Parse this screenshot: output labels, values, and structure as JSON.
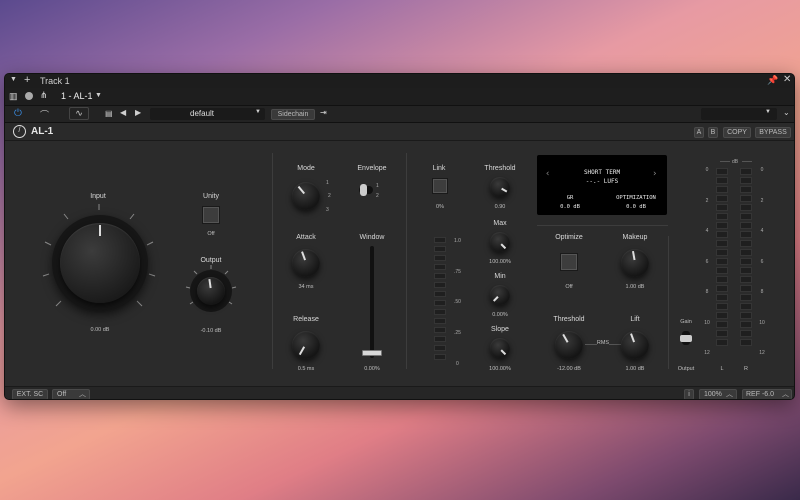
{
  "host": {
    "track_title": "Track 1",
    "track_select": "1 - AL-1",
    "preset": "default",
    "sidechain": "Sidechain"
  },
  "plugin": {
    "name": "AL-1",
    "ab": [
      "A",
      "B"
    ],
    "copy": "COPY",
    "bypass": "BYPASS"
  },
  "input": {
    "label": "Input",
    "value": "0.00 dB"
  },
  "unity": {
    "label": "Unity",
    "value": "Off"
  },
  "output": {
    "label": "Output",
    "value": "-0.10 dB"
  },
  "mode": {
    "label": "Mode",
    "positions": [
      "1",
      "2",
      "3"
    ]
  },
  "envelope": {
    "label": "Envelope",
    "positions": [
      "1",
      "2"
    ]
  },
  "attack": {
    "label": "Attack",
    "value": "34 ms"
  },
  "release": {
    "label": "Release",
    "value": "0.5 ms"
  },
  "window": {
    "label": "Window",
    "value": "0.00%",
    "level": 0.0
  },
  "link": {
    "label": "Link",
    "value": "0%",
    "scale": [
      "1.0",
      ".75",
      ".50",
      ".25",
      "0"
    ]
  },
  "threshold_top": {
    "label": "Threshold",
    "value": "0.90"
  },
  "max": {
    "label": "Max",
    "value": "100.00%"
  },
  "min": {
    "label": "Min",
    "value": "0.00%"
  },
  "slope": {
    "label": "Slope",
    "value": "100.00%"
  },
  "display": {
    "title": "SHORT TERM",
    "lufs": "--.- LUFS",
    "gr_label": "GR",
    "gr_value": "0.0 dB",
    "opt_label": "OPTIMIZATION",
    "opt_value": "0.0 dB"
  },
  "optimize": {
    "label": "Optimize",
    "value": "Off"
  },
  "makeup": {
    "label": "Makeup",
    "value": "1.00 dB"
  },
  "threshold": {
    "label": "Threshold",
    "value": "-12.00 dB",
    "rms": "RMS"
  },
  "lift": {
    "label": "Lift",
    "value": "1.00 dB"
  },
  "gain_switch": {
    "top": "Gain",
    "bottom": "Output"
  },
  "meter": {
    "unit": "dB",
    "scale": [
      "0",
      "2",
      "4",
      "6",
      "8",
      "10",
      "12"
    ],
    "left": "L",
    "right": "R"
  },
  "bottom": {
    "ext_sc": "EXT. SC",
    "off": "Off",
    "info": "i",
    "zoom": "100%",
    "ref": "REF -6.0"
  }
}
